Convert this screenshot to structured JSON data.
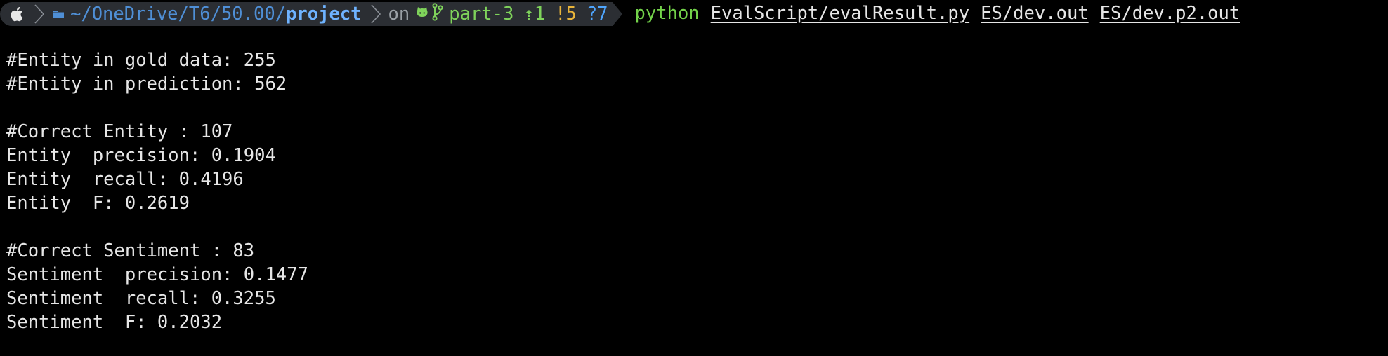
{
  "prompt": {
    "path_prefix": "~/OneDrive",
    "path_middle": " /T6/50.00/",
    "path_current": "project",
    "on_word": "on",
    "git_branch": "part-3",
    "git_ahead": "⇡1",
    "git_modified": "!5",
    "git_untracked": "?7",
    "icons": {
      "os": "apple-icon",
      "folder": "folder-icon",
      "github": "github-icon",
      "branch": "git-branch-icon"
    }
  },
  "command": {
    "program": "python",
    "args": [
      "EvalScript/evalResult.py",
      "ES/dev.out",
      "ES/dev.p2.out"
    ]
  },
  "output": {
    "lines": [
      "#Entity in gold data: 255",
      "#Entity in prediction: 562",
      "",
      "#Correct Entity : 107",
      "Entity  precision: 0.1904",
      "Entity  recall: 0.4196",
      "Entity  F: 0.2619",
      "",
      "#Correct Sentiment : 83",
      "Sentiment  precision: 0.1477",
      "Sentiment  recall: 0.3255",
      "Sentiment  F: 0.2032"
    ]
  },
  "colors": {
    "background": "#000000",
    "text": "#e6e6e6",
    "segment_bg": "#2b2e33",
    "path_blue": "#4f8fd6",
    "path_bright": "#6fb3ff",
    "git_green": "#7fd35b",
    "modified_yellow": "#e9b43a",
    "command_green": "#73d24a"
  }
}
